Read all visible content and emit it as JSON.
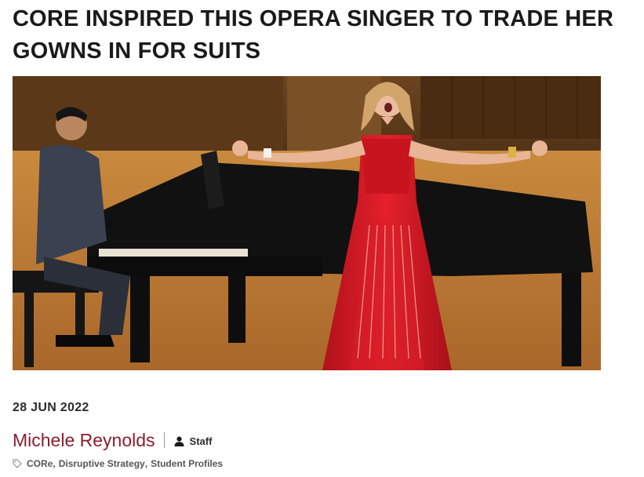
{
  "article": {
    "headline_line1": "CORE INSPIRED THIS OPERA SINGER TO TRADE HER",
    "headline_line2": "GOWNS IN FOR SUITS",
    "date": "28 JUN 2022",
    "author": "Michele Reynolds",
    "author_role": "Staff",
    "tags": [
      "CORe",
      "Disruptive Strategy",
      "Student Profiles"
    ]
  },
  "icons": {
    "role": "person-icon",
    "tags": "tag-icon"
  },
  "colors": {
    "author_link": "#8c1d2e",
    "headline": "#1a1a1a",
    "meta_text": "#555555"
  }
}
